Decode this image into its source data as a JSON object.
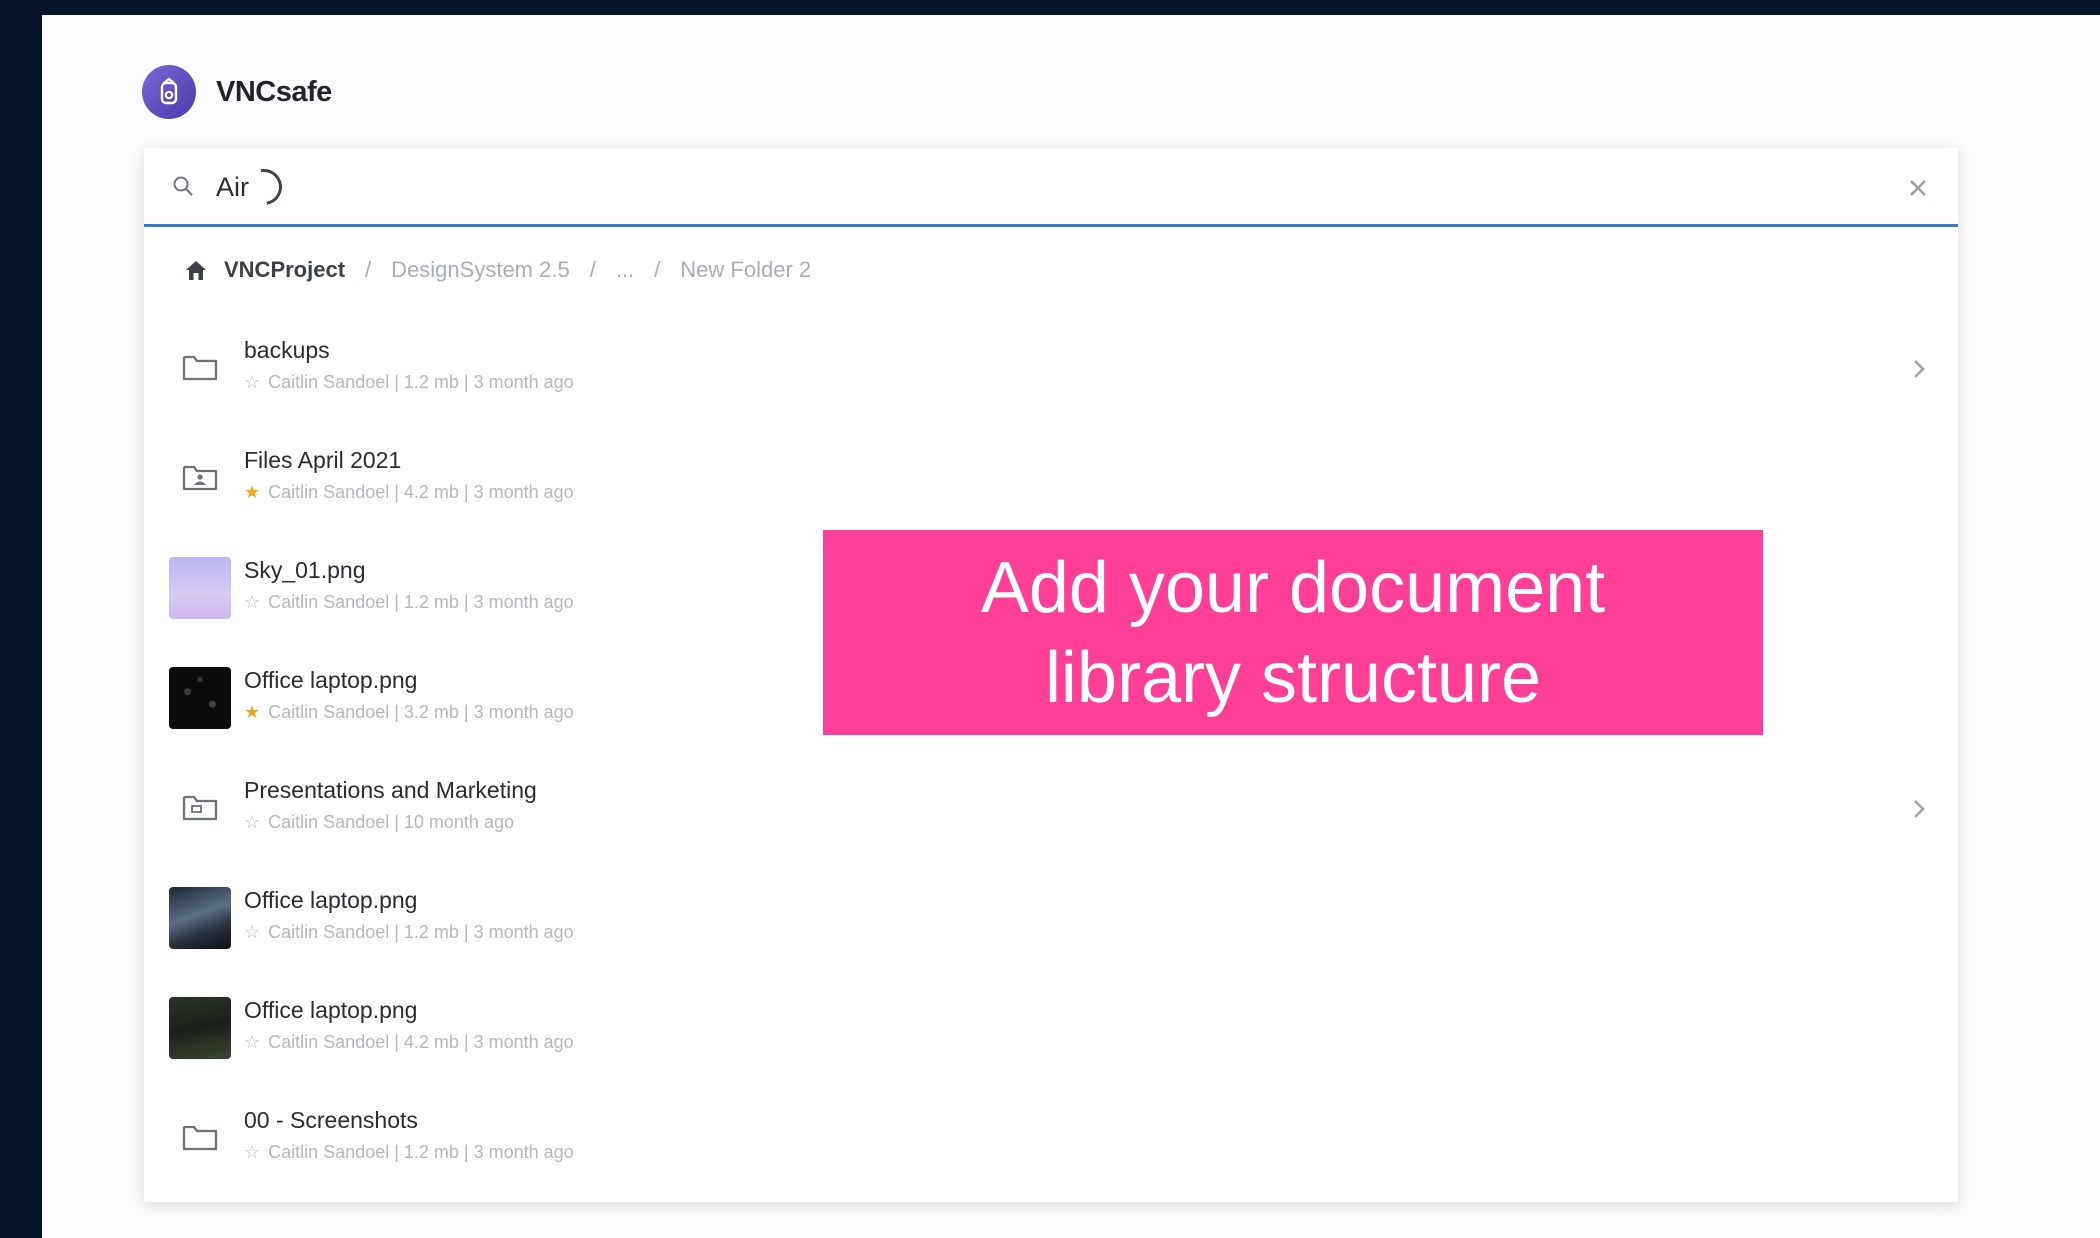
{
  "app": {
    "title": "VNCsafe"
  },
  "search": {
    "value": "Air"
  },
  "breadcrumb": {
    "home": "VNCProject",
    "items": [
      "DesignSystem 2.5",
      "...",
      "New Folder 2"
    ]
  },
  "rows": [
    {
      "name": "backups",
      "meta": "Caitlin Sandoel | 1.2 mb | 3 month ago",
      "starred": false,
      "kind": "folder",
      "icon": "folder-icon",
      "has_chevron": true
    },
    {
      "name": "Files April 2021",
      "meta": "Caitlin Sandoel | 4.2 mb | 3 month ago",
      "starred": true,
      "kind": "shared-folder",
      "icon": "shared-folder-icon",
      "has_chevron": false
    },
    {
      "name": "Sky_01.png",
      "meta": "Caitlin Sandoel | 1.2 mb | 3 month ago",
      "starred": false,
      "kind": "image",
      "icon": "sky-thumbnail",
      "has_chevron": false
    },
    {
      "name": "Office laptop.png",
      "meta": "Caitlin Sandoel | 3.2 mb | 3 month ago",
      "starred": true,
      "kind": "image",
      "icon": "dark-thumbnail",
      "has_chevron": false
    },
    {
      "name": "Presentations and Marketing",
      "meta": "Caitlin Sandoel | 10 month ago",
      "starred": false,
      "kind": "shared-folder",
      "icon": "shared-folder-icon",
      "has_chevron": true
    },
    {
      "name": "Office laptop.png",
      "meta": "Caitlin Sandoel | 1.2 mb | 3 month ago",
      "starred": false,
      "kind": "image",
      "icon": "city-thumbnail",
      "has_chevron": false
    },
    {
      "name": "Office laptop.png",
      "meta": "Caitlin Sandoel | 4.2 mb | 3 month ago",
      "starred": false,
      "kind": "image",
      "icon": "forest-thumbnail",
      "has_chevron": false
    },
    {
      "name": "00 - Screenshots",
      "meta": "Caitlin Sandoel | 1.2 mb | 3 month ago",
      "starred": false,
      "kind": "folder",
      "icon": "folder-icon",
      "has_chevron": false
    }
  ],
  "callout": {
    "line1": "Add your document",
    "line2": "library structure"
  },
  "colors": {
    "accent": "#2f7ad6",
    "callout": "#ff3f97",
    "star": "#f2a71c",
    "background": "#03132a"
  }
}
